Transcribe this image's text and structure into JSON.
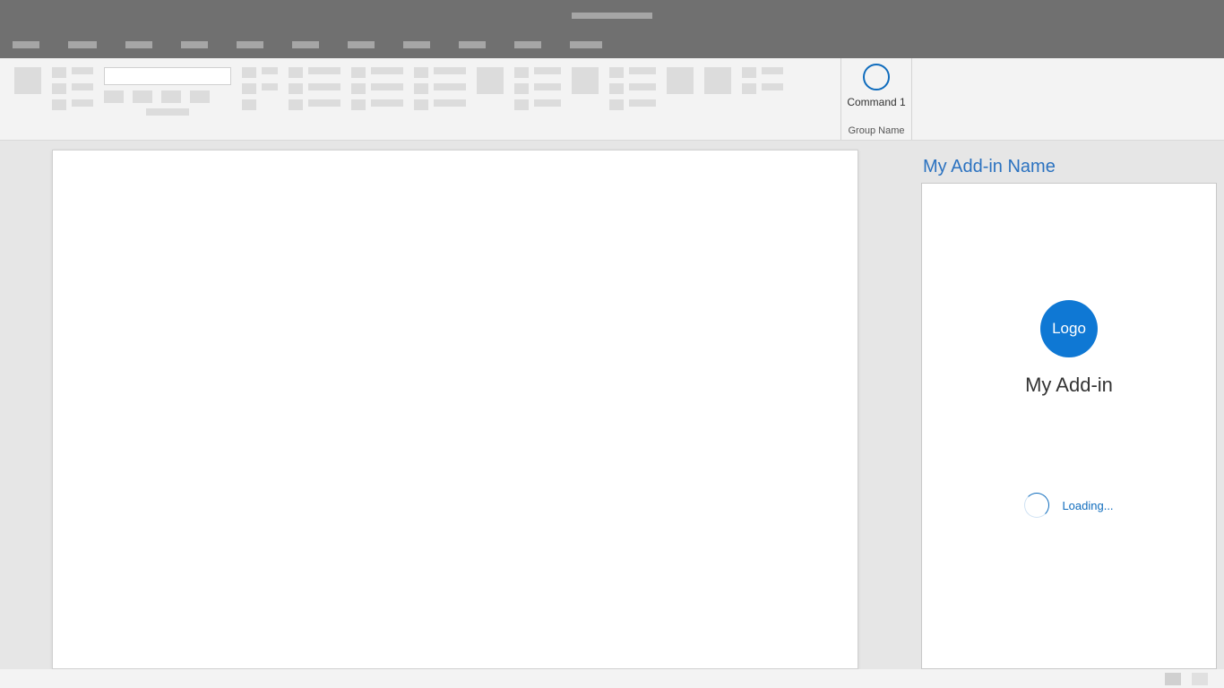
{
  "ribbon": {
    "command": {
      "label": "Command 1",
      "group_label": "Group Name"
    }
  },
  "task_pane": {
    "title": "My Add-in Name",
    "logo_text": "Logo",
    "addin_name": "My Add-in",
    "loading_text": "Loading..."
  }
}
